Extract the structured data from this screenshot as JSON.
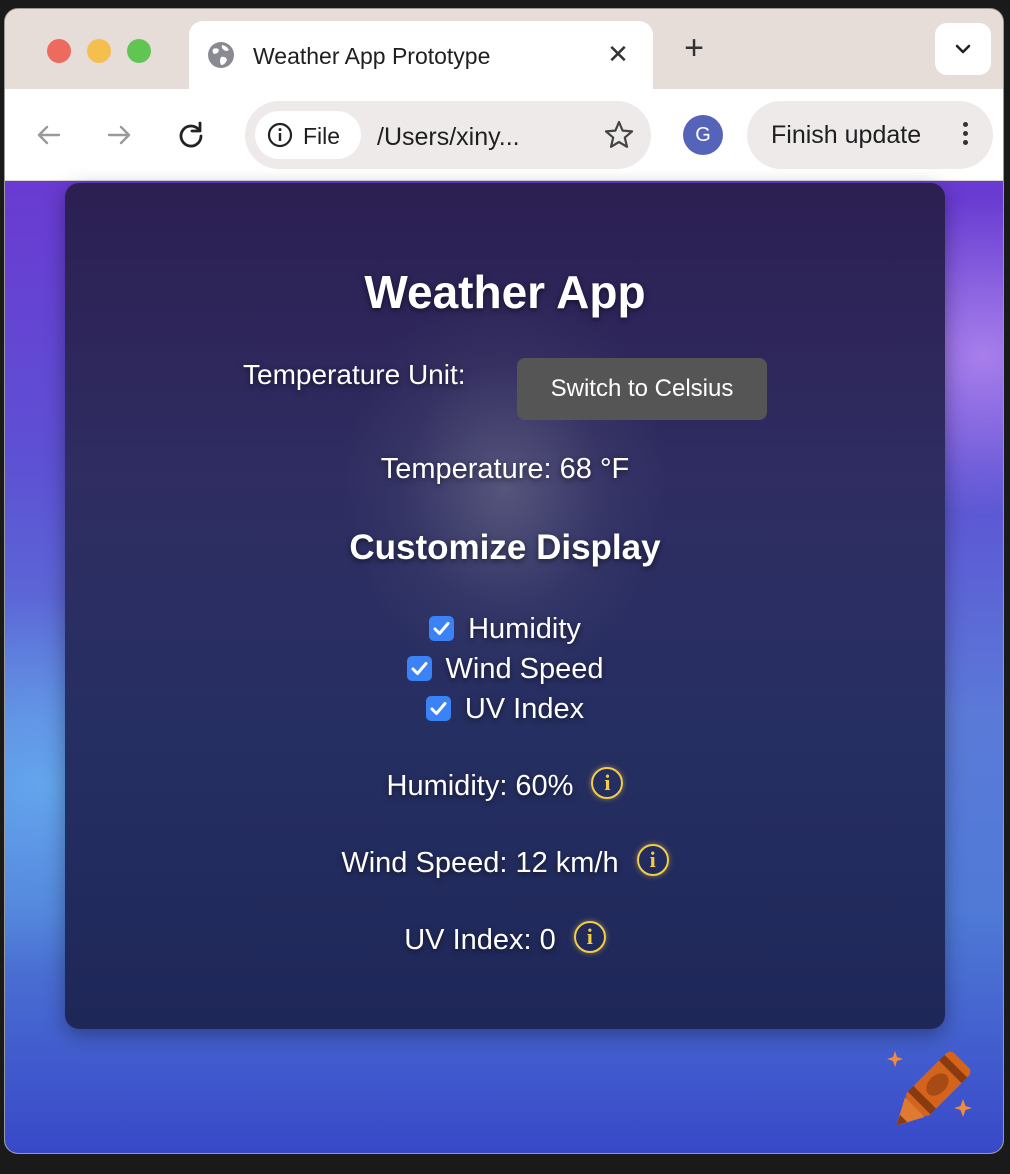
{
  "browser": {
    "tab_title": "Weather App Prototype",
    "tab_close": "✕",
    "new_tab": "+",
    "site_chip_label": "File",
    "url": "/Users/xiny...",
    "profile_initial": "G",
    "update_label": "Finish update"
  },
  "app": {
    "title": "Weather App",
    "unit_label": "Temperature Unit:",
    "unit_button": "Switch to Celsius",
    "temperature": "Temperature: 68 °F",
    "customize_title": "Customize Display",
    "toggles": [
      {
        "label": "Humidity",
        "checked": true
      },
      {
        "label": "Wind Speed",
        "checked": true
      },
      {
        "label": "UV Index",
        "checked": true
      }
    ],
    "stats": [
      {
        "text": "Humidity: 60%"
      },
      {
        "text": "Wind Speed: 12 km/h"
      },
      {
        "text": "UV Index: 0"
      }
    ],
    "info_glyph": "i",
    "accent_color": "#f3cd48",
    "checkbox_color": "#3b82f6"
  }
}
